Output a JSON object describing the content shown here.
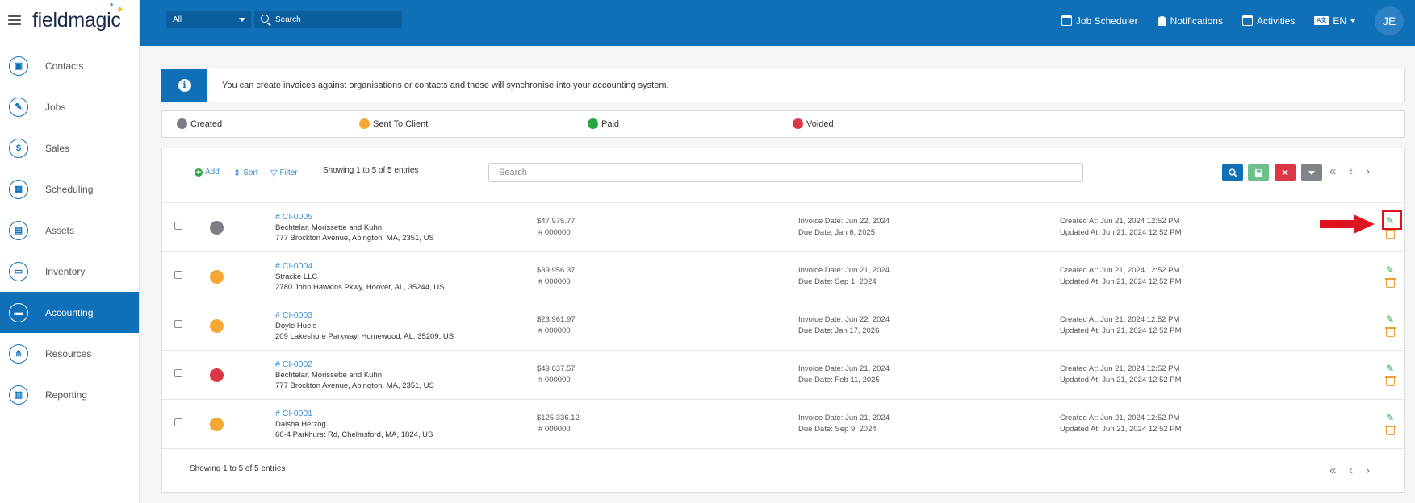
{
  "app": {
    "logo_prefix": "field",
    "logo_suffix": "magic"
  },
  "sidebar": {
    "items": [
      {
        "label": "Contacts",
        "icon": "contact-card-icon"
      },
      {
        "label": "Jobs",
        "icon": "wrench-icon"
      },
      {
        "label": "Sales",
        "icon": "dollar-icon"
      },
      {
        "label": "Scheduling",
        "icon": "calendar-icon"
      },
      {
        "label": "Assets",
        "icon": "briefcase-icon"
      },
      {
        "label": "Inventory",
        "icon": "inventory-icon"
      },
      {
        "label": "Accounting",
        "icon": "wallet-icon",
        "active": true
      },
      {
        "label": "Resources",
        "icon": "network-icon"
      },
      {
        "label": "Reporting",
        "icon": "report-icon"
      }
    ]
  },
  "topbar": {
    "scope_value": "All",
    "search_placeholder": "Search",
    "job_scheduler": "Job Scheduler",
    "notifications": "Notifications",
    "activities": "Activities",
    "language": "EN",
    "avatar_initials": "JE"
  },
  "info": {
    "text": "You can create invoices against organisations or contacts and these will synchronise into your accounting system."
  },
  "legend": {
    "items": [
      {
        "label": "Created",
        "color": "#7a7d82"
      },
      {
        "label": "Sent To Client",
        "color": "#f5a733"
      },
      {
        "label": "Paid",
        "color": "#28a745"
      },
      {
        "label": "Voided",
        "color": "#dc3545"
      }
    ]
  },
  "toolbar": {
    "add": "Add",
    "sort": "Sort",
    "filter": "Filter",
    "showing": "Showing 1 to 5 of 5 entries",
    "search_placeholder": "Search"
  },
  "invoices": [
    {
      "ref": "# CI-0005",
      "customer": "Bechtelar, Morissette and Kuhn",
      "address": "777 Brockton Avenue, Abington, MA, 2351, US",
      "amount": "$47,975.77",
      "number": "#   000000",
      "invoice_date": "Invoice Date: Jun 22, 2024",
      "due_date": "Due Date: Jan 6, 2025",
      "created": "Created At: Jun 21, 2024 12:52 PM",
      "updated": "Updated At: Jun 21, 2024 12:52 PM",
      "status_color": "#7a7d82"
    },
    {
      "ref": "# CI-0004",
      "customer": "Stracke LLC",
      "address": "2780 John Hawkins Pkwy, Hoover, AL, 35244, US",
      "amount": "$39,956.37",
      "number": "#   000000",
      "invoice_date": "Invoice Date: Jun 21, 2024",
      "due_date": "Due Date: Sep 1, 2024",
      "created": "Created At: Jun 21, 2024 12:52 PM",
      "updated": "Updated At: Jun 21, 2024 12:52 PM",
      "status_color": "#f5a733"
    },
    {
      "ref": "# CI-0003",
      "customer": "Doyle Huels",
      "address": "209 Lakeshore Parkway, Homewood, AL, 35209, US",
      "amount": "$23,961.97",
      "number": "#   000000",
      "invoice_date": "Invoice Date: Jun 22, 2024",
      "due_date": "Due Date: Jan 17, 2026",
      "created": "Created At: Jun 21, 2024 12:52 PM",
      "updated": "Updated At: Jun 21, 2024 12:52 PM",
      "status_color": "#f5a733"
    },
    {
      "ref": "# CI-0002",
      "customer": "Bechtelar, Morissette and Kuhn",
      "address": "777 Brockton Avenue, Abington, MA, 2351, US",
      "amount": "$49,637.57",
      "number": "#   000000",
      "invoice_date": "Invoice Date: Jun 21, 2024",
      "due_date": "Due Date: Feb 11, 2025",
      "created": "Created At: Jun 21, 2024 12:52 PM",
      "updated": "Updated At: Jun 21, 2024 12:52 PM",
      "status_color": "#dc3545"
    },
    {
      "ref": "# CI-0001",
      "customer": "Daisha Herzog",
      "address": "66-4 Parkhurst Rd, Chelmsford, MA, 1824, US",
      "amount": "$125,336.12",
      "number": "#   000000",
      "invoice_date": "Invoice Date: Jun 21, 2024",
      "due_date": "Due Date: Sep 9, 2024",
      "created": "Created At: Jun 21, 2024 12:52 PM",
      "updated": "Updated At: Jun 21, 2024 12:52 PM",
      "status_color": "#f5a733"
    }
  ],
  "footer": {
    "showing": "Showing 1 to 5 of 5 entries"
  },
  "colors": {
    "primary": "#0f70b7",
    "link": "#3a8fd4",
    "highlight": "#e0141e"
  }
}
